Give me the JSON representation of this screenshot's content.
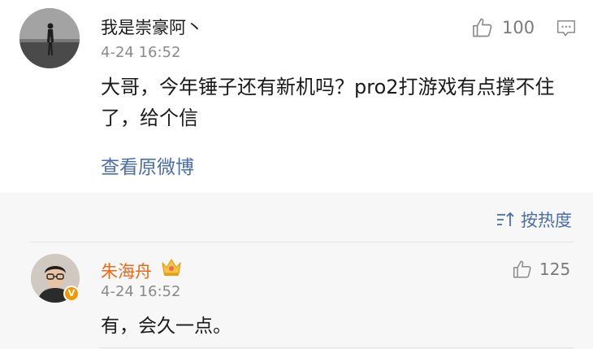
{
  "post": {
    "username": "我是崇豪阿丶",
    "time": "4-24 16:52",
    "like_count": "100",
    "content": "大哥，今年锤子还有新机吗？pro2打游戏有点撑不住了，给个信",
    "view_original_label": "查看原微博"
  },
  "sort": {
    "label": "按热度",
    "icon": "sort-icon"
  },
  "reply": {
    "username": "朱海舟",
    "time": "4-24 16:52",
    "like_count": "125",
    "content": "有，会久一点。",
    "badge_icon": "verified-v-icon",
    "crown_icon": "crown-icon"
  },
  "colors": {
    "link_blue": "#4a6ea8",
    "reply_name_orange": "#e86b1a",
    "verified_badge": "#f39800",
    "meta_gray": "#8a8a8a"
  }
}
